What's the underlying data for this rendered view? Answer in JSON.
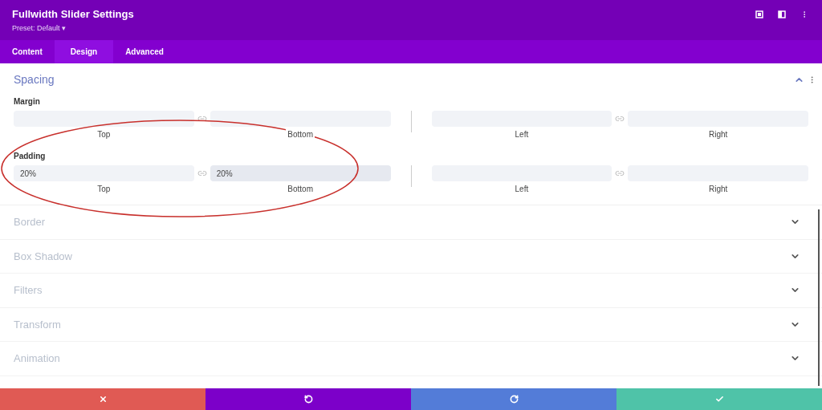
{
  "header": {
    "title": "Fullwidth Slider Settings",
    "preset": "Preset: Default ▾"
  },
  "tabs": [
    {
      "label": "Content",
      "selected": false
    },
    {
      "label": "Design",
      "selected": true
    },
    {
      "label": "Advanced",
      "selected": false
    }
  ],
  "spacing": {
    "title": "Spacing",
    "expanded": true,
    "groups": [
      {
        "label": "Margin",
        "pairs": [
          [
            {
              "caption": "Top",
              "focused": false
            },
            {
              "caption": "Bottom",
              "focused": false
            }
          ],
          [
            {
              "caption": "Left",
              "focused": false
            },
            {
              "caption": "Right",
              "focused": false
            }
          ]
        ]
      },
      {
        "label": "Padding",
        "pairs": [
          [
            {
              "value": "20%",
              "caption": "Top",
              "focused": false
            },
            {
              "value": "20%",
              "caption": "Bottom",
              "focused": true
            }
          ],
          [
            {
              "caption": "Left",
              "focused": false
            },
            {
              "caption": "Right",
              "focused": false
            }
          ]
        ]
      }
    ]
  },
  "sections": [
    {
      "title": "Border",
      "expanded": false
    },
    {
      "title": "Box Shadow",
      "expanded": false
    },
    {
      "title": "Filters",
      "expanded": false
    },
    {
      "title": "Transform",
      "expanded": false
    },
    {
      "title": "Animation",
      "expanded": false
    }
  ],
  "footer": [
    {
      "kind": "cancel"
    },
    {
      "kind": "undo"
    },
    {
      "kind": "redo"
    },
    {
      "kind": "save"
    }
  ]
}
